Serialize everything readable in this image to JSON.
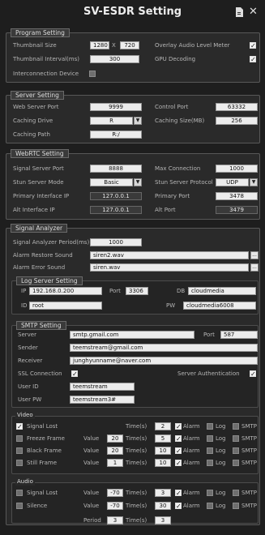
{
  "header": {
    "title": "SV-ESDR Setting",
    "save_icon": "save-icon",
    "close_icon": "close-icon"
  },
  "program": {
    "section": "Program Setting",
    "thumb_size_label": "Thumbnail Size",
    "thumb_w": "1280",
    "x": "X",
    "thumb_h": "720",
    "thumb_interval_label": "Thumbnail Interval(ms)",
    "thumb_interval": "300",
    "interconnection_label": "Interconnection Device",
    "overlay_label": "Overlay Audio Level Meter",
    "gpu_label": "GPU Decoding"
  },
  "server": {
    "section": "Server Setting",
    "web_port_label": "Web Server Port",
    "web_port": "9999",
    "control_port_label": "Control Port",
    "control_port": "63332",
    "caching_drive_label": "Caching Drive",
    "caching_drive": "R",
    "caching_size_label": "Caching Size(MB)",
    "caching_size": "256",
    "caching_path_label": "Caching Path",
    "caching_path": "R:/"
  },
  "webrtc": {
    "section": "WebRTC Setting",
    "signal_port_label": "Signal Server Port",
    "signal_port": "8888",
    "max_conn_label": "Max Connection",
    "max_conn": "1000",
    "stun_mode_label": "Stun Server Mode",
    "stun_mode": "Basic",
    "stun_proto_label": "Stun Server Protocol",
    "stun_proto": "UDP",
    "primary_ip_label": "Primary Interface IP",
    "primary_ip": "127.0.0.1",
    "primary_port_label": "Primary Port",
    "primary_port": "3478",
    "alt_ip_label": "Alt Interface IP",
    "alt_ip": "127.0.0.1",
    "alt_port_label": "Alt Port",
    "alt_port": "3479"
  },
  "analyzer": {
    "section": "Signal Analyzer",
    "period_label": "Signal Analyzer Period(ms)",
    "period": "1000",
    "restore_label": "Alarm Restore Sound",
    "restore": "siren2.wav",
    "error_label": "Alarm Error Sound",
    "error": "siren.wav",
    "ellipsis": "..."
  },
  "log": {
    "section": "Log Server Setting",
    "ip_label": "IP",
    "ip": "192.168.0.200",
    "port_label": "Port",
    "port": "3306",
    "db_label": "DB",
    "db": "cloudmedia",
    "id_label": "ID",
    "id": "root",
    "pw_label": "PW",
    "pw": "cloudmedia6008"
  },
  "smtp": {
    "section": "SMTP Setting",
    "server_label": "Server",
    "server": "smtp.gmail.com",
    "port_label": "Port",
    "port": "587",
    "sender_label": "Sender",
    "sender": "teemstream@gmail.com",
    "receiver_label": "Receiver",
    "receiver": "junghyunname@naver.com",
    "ssl_label": "SSL Connection",
    "auth_label": "Server Authentication",
    "userid_label": "User ID",
    "userid": "teemstream",
    "userpw_label": "User PW",
    "userpw": "teemstream3#"
  },
  "video": {
    "section": "Video",
    "value_label": "Value",
    "times_label": "Time(s)",
    "alarm_label": "Alarm",
    "log_label": "Log",
    "smtp_label": "SMTP",
    "rows": [
      {
        "name": "Signal Lost",
        "value": "",
        "time": "2",
        "checked": true,
        "alarm": true,
        "log": false,
        "smtp": false
      },
      {
        "name": "Freeze Frame",
        "value": "20",
        "time": "5",
        "checked": false,
        "alarm": true,
        "log": false,
        "smtp": false
      },
      {
        "name": "Black Frame",
        "value": "20",
        "time": "10",
        "checked": false,
        "alarm": true,
        "log": false,
        "smtp": false
      },
      {
        "name": "Still Frame",
        "value": "1",
        "time": "10",
        "checked": false,
        "alarm": true,
        "log": false,
        "smtp": false
      }
    ]
  },
  "audio": {
    "section": "Audio",
    "value_label": "Value",
    "times_label": "Time(s)",
    "period_label": "Period",
    "alarm_label": "Alarm",
    "log_label": "Log",
    "smtp_label": "SMTP",
    "rows": [
      {
        "name": "Signal Lost",
        "value": "-70",
        "time": "3",
        "checked": false,
        "alarm": true,
        "log": false,
        "smtp": false
      },
      {
        "name": "Silence",
        "value": "-70",
        "time": "30",
        "checked": false,
        "alarm": true,
        "log": false,
        "smtp": false
      }
    ],
    "period": "3",
    "period_time": "3"
  }
}
